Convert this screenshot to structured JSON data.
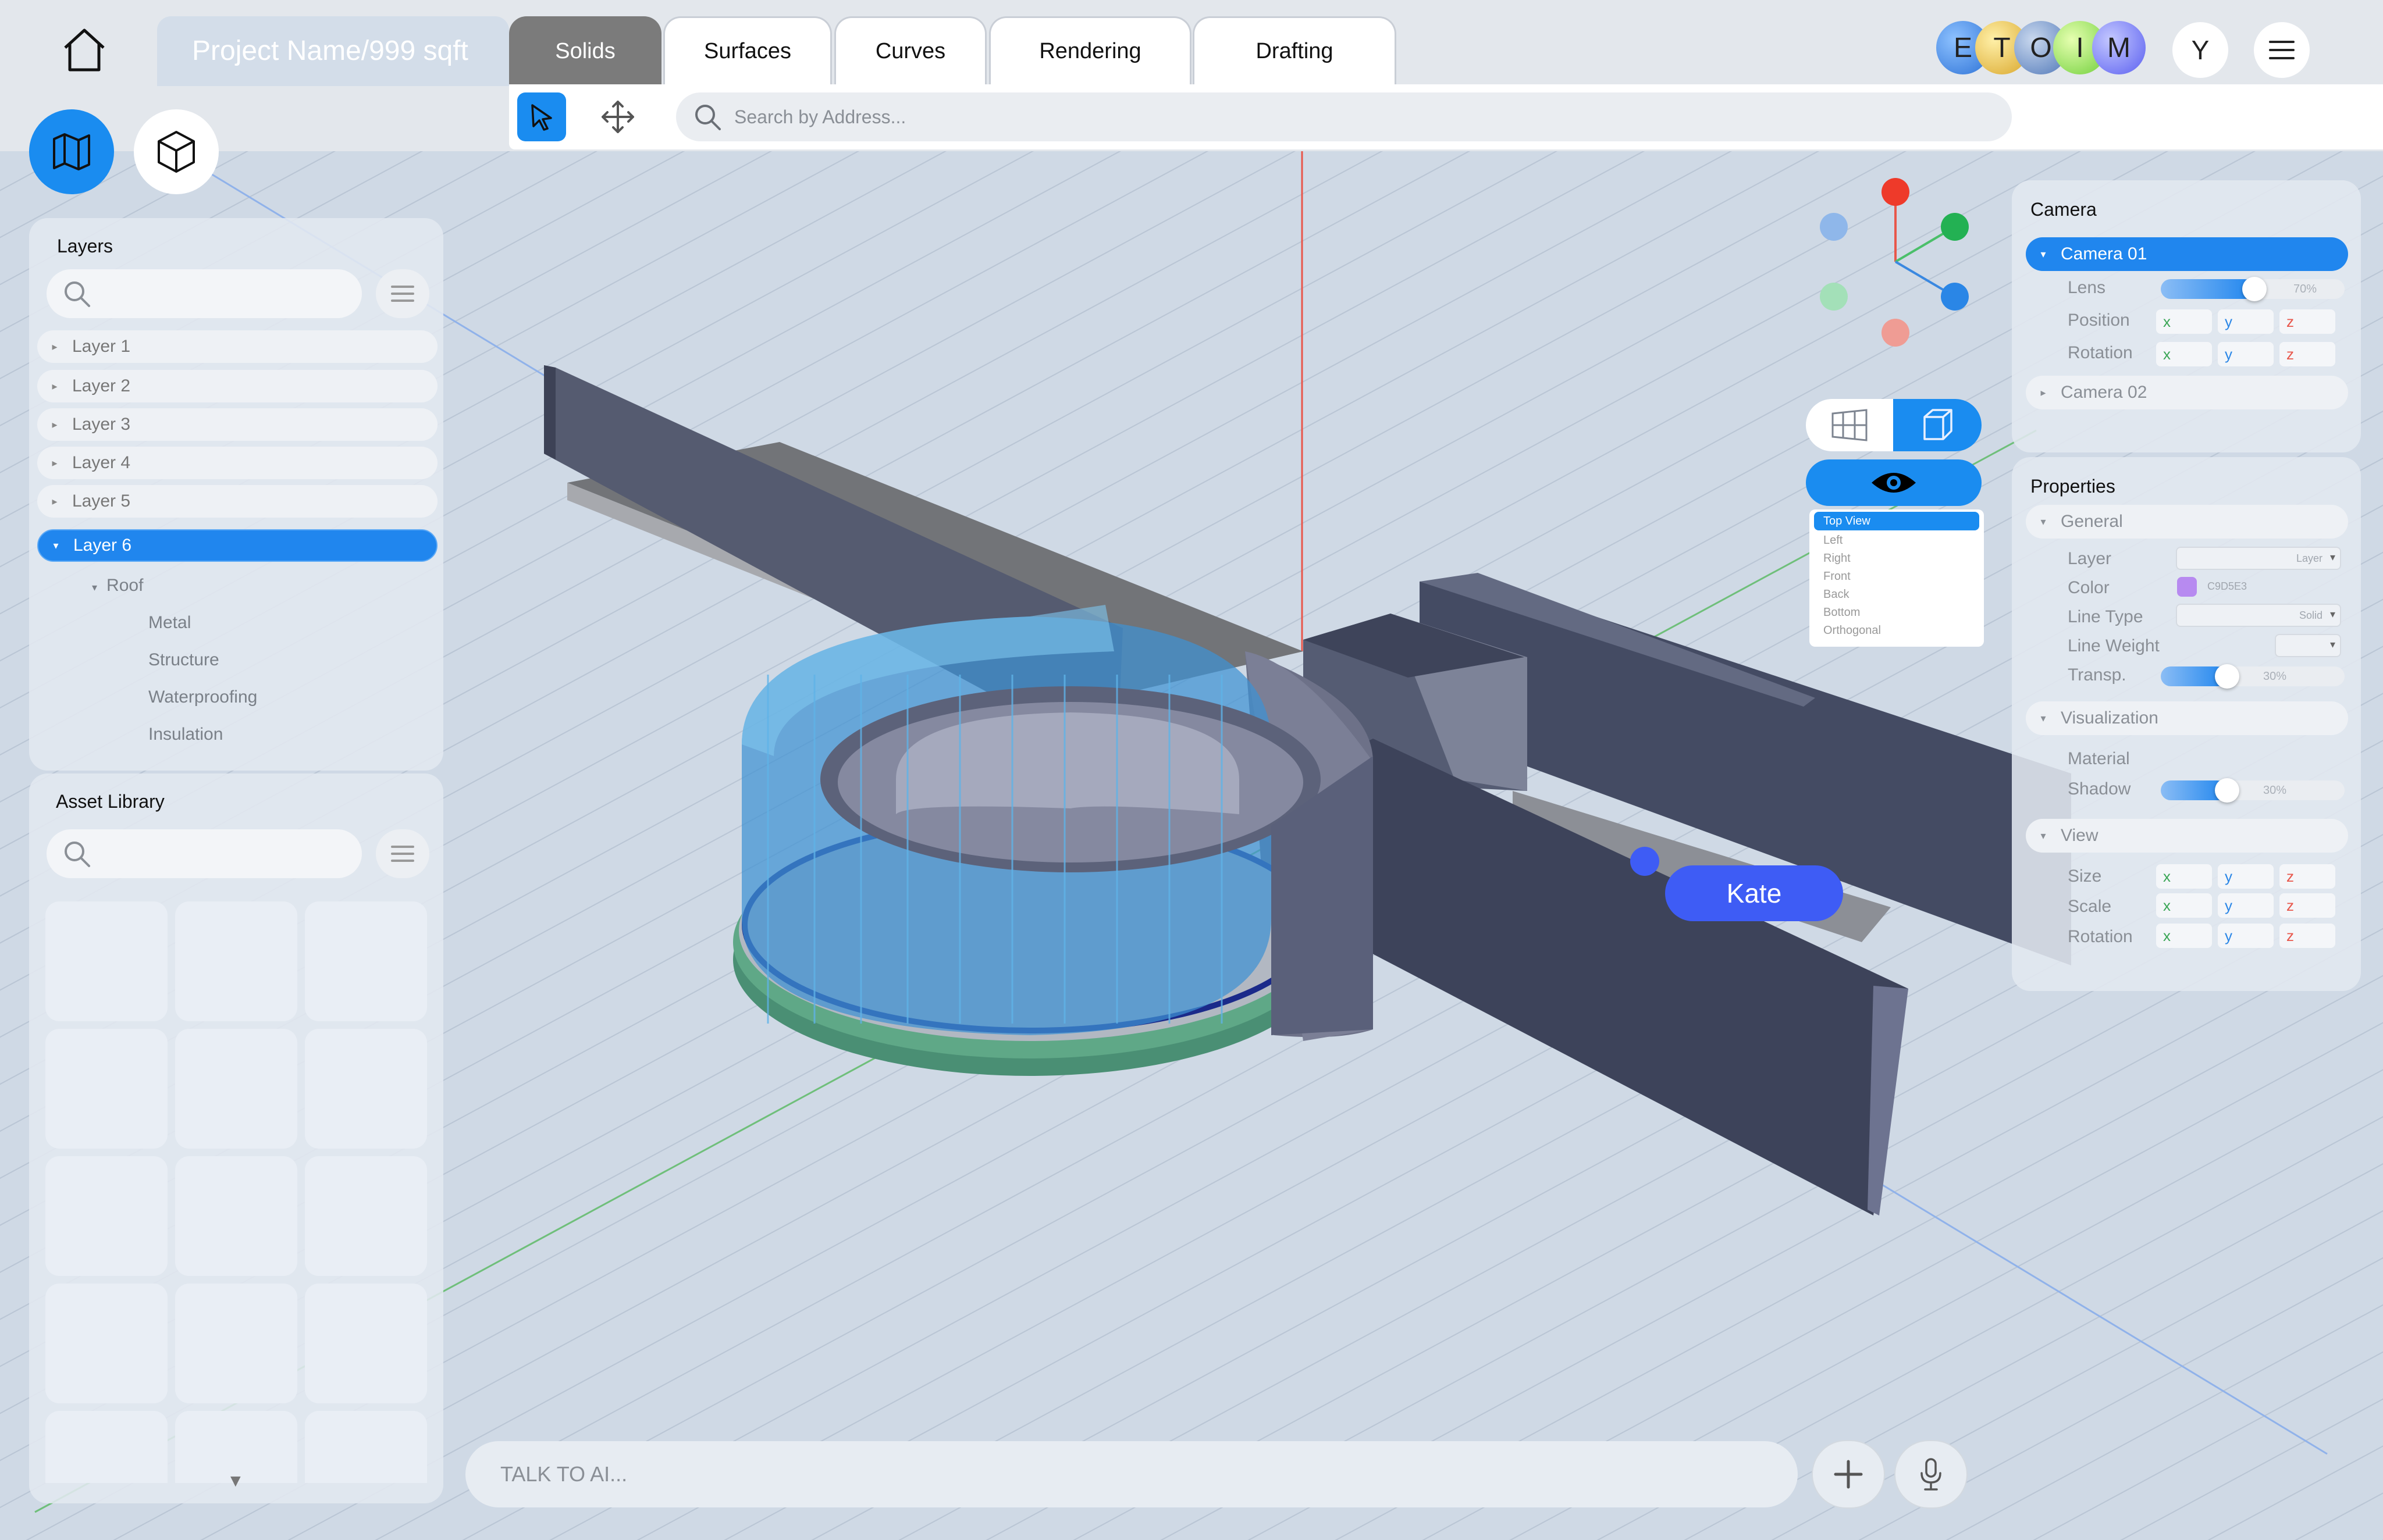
{
  "header": {
    "project_name": "Project Name/999 sqft",
    "tabs": [
      {
        "label": "Solids"
      },
      {
        "label": "Surfaces"
      },
      {
        "label": "Curves"
      },
      {
        "label": "Rendering"
      },
      {
        "label": "Drafting"
      }
    ],
    "collaborators": [
      {
        "initial": "E",
        "color": "#4a90e2"
      },
      {
        "initial": "T",
        "color": "#e8c55a"
      },
      {
        "initial": "O",
        "color": "#6e97c8"
      },
      {
        "initial": "I",
        "color": "#9fe06a"
      },
      {
        "initial": "M",
        "color": "#7a7ff0"
      }
    ],
    "user_initial": "Y",
    "menu_icon": "hamburger-icon"
  },
  "toolbar": {
    "search_placeholder": "Search by Address..."
  },
  "layers": {
    "title": "Layers",
    "items": [
      {
        "label": "Layer 1"
      },
      {
        "label": "Layer 2"
      },
      {
        "label": "Layer 3"
      },
      {
        "label": "Layer 4"
      },
      {
        "label": "Layer 5"
      },
      {
        "label": "Layer 6"
      }
    ],
    "sub": {
      "group": "Roof",
      "children": [
        "Metal",
        "Structure",
        "Waterproofing",
        "Insulation"
      ]
    }
  },
  "asset_library": {
    "title": "Asset Library"
  },
  "camera": {
    "title": "Camera",
    "camera1": "Camera 01",
    "lens_label": "Lens",
    "lens_value": "70%",
    "lens_level": 0.7,
    "position_label": "Position",
    "rotation_label": "Rotation",
    "x": "x",
    "y": "y",
    "z": "z",
    "camera2": "Camera 02"
  },
  "properties": {
    "title": "Properties",
    "general": "General",
    "layer_label": "Layer",
    "layer_value": "Layer",
    "color_label": "Color",
    "color_value": "C9D5E3",
    "color_swatch": "#b78af0",
    "line_type_label": "Line Type",
    "line_type_value": "Solid",
    "line_weight_label": "Line Weight",
    "transp_label": "Transp.",
    "transp_value": "30%",
    "transp_level": 0.3,
    "visualization": "Visualization",
    "material_label": "Material",
    "shadow_label": "Shadow",
    "shadow_value": "30%",
    "view": "View",
    "size_label": "Size",
    "scale_label": "Scale",
    "rotation_label": "Rotation"
  },
  "view_menu": {
    "items": [
      "Top View",
      "Left",
      "Right",
      "Front",
      "Back",
      "Bottom",
      "Orthogonal"
    ]
  },
  "collab_tag": "Kate",
  "ai": {
    "placeholder": "TALK TO AI..."
  },
  "colors": {
    "accent": "#1a8cf0",
    "selection": "#2086ee",
    "collab": "#3e5cf5"
  }
}
